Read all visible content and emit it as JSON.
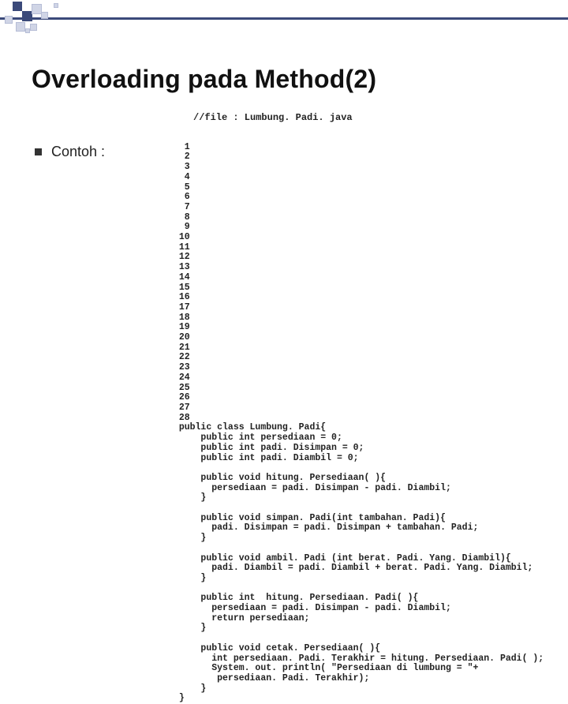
{
  "title": "Overloading pada Method(2)",
  "bullet_label": "Contoh :",
  "file_comment": "//file : Lumbung. Padi. java",
  "code_lines": [
    "public class Lumbung. Padi{",
    "    public int persediaan = 0;",
    "    public int padi. Disimpan = 0;",
    "    public int padi. Diambil = 0;",
    "",
    "    public void hitung. Persediaan( ){",
    "      persediaan = padi. Disimpan - padi. Diambil;",
    "    }",
    "",
    "    public void simpan. Padi(int tambahan. Padi){",
    "      padi. Disimpan = padi. Disimpan + tambahan. Padi;",
    "    }",
    "",
    "    public void ambil. Padi (int berat. Padi. Yang. Diambil){",
    "      padi. Diambil = padi. Diambil + berat. Padi. Yang. Diambil;",
    "    }",
    "",
    "    public int  hitung. Persediaan. Padi( ){",
    "      persediaan = padi. Disimpan - padi. Diambil;",
    "      return persediaan;",
    "    }",
    "",
    "    public void cetak. Persediaan( ){",
    "      int persediaan. Padi. Terakhir = hitung. Persediaan. Padi( );",
    "      System. out. println( \"Persediaan di lumbung = \"+",
    "       persediaan. Padi. Terakhir);",
    "    }",
    "}"
  ]
}
